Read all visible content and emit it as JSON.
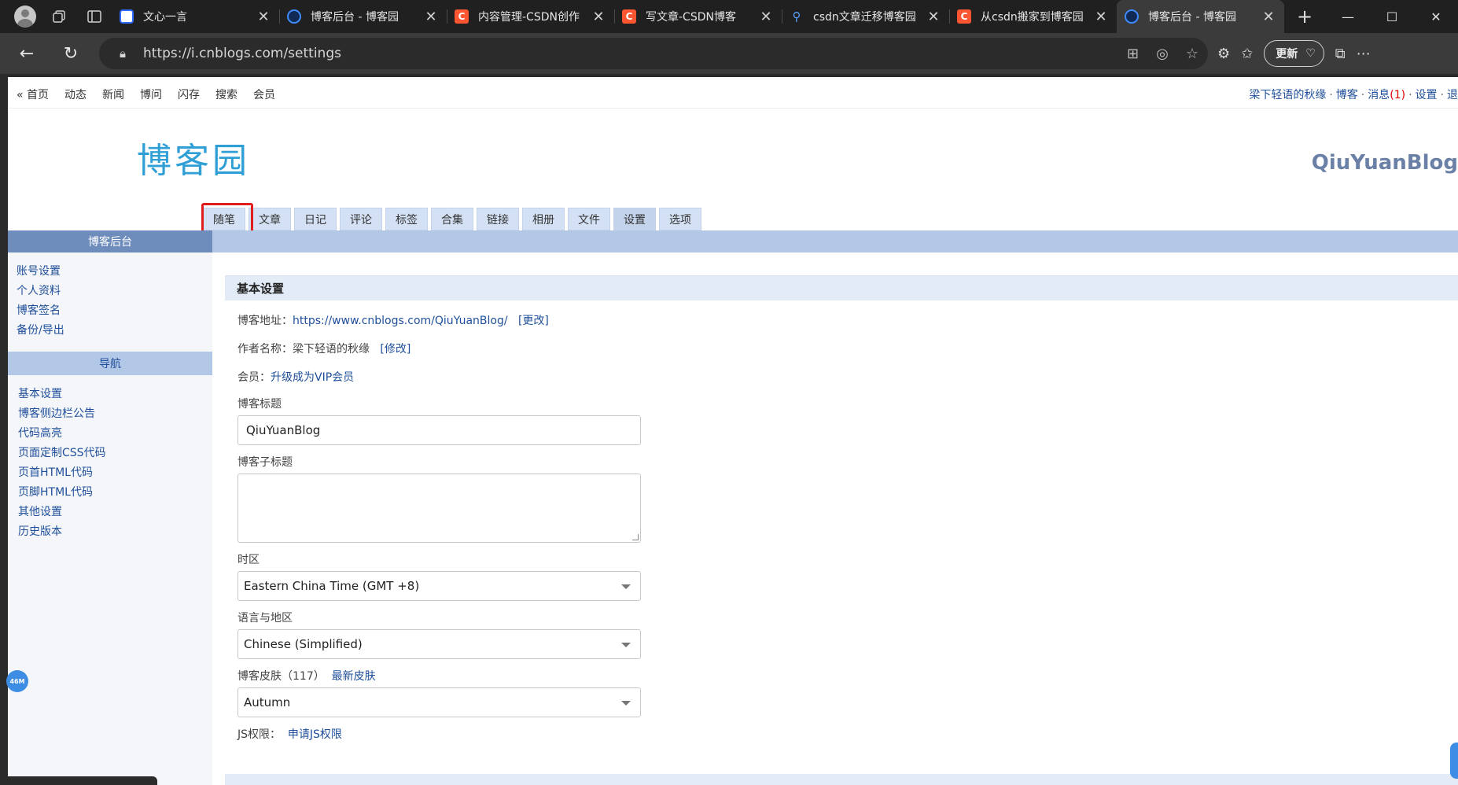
{
  "browser": {
    "tabs": [
      {
        "title": "文心一言",
        "favicon": "wenxin-icon",
        "active": false
      },
      {
        "title": "博客后台 - 博客园",
        "favicon": "cnblogs-icon",
        "active": false
      },
      {
        "title": "内容管理-CSDN创作",
        "favicon": "csdn-icon",
        "active": false
      },
      {
        "title": "写文章-CSDN博客",
        "favicon": "csdn-icon",
        "active": false
      },
      {
        "title": "csdn文章迁移博客园",
        "favicon": "search-icon",
        "active": false
      },
      {
        "title": "从csdn搬家到博客园",
        "favicon": "csdn-icon",
        "active": false
      },
      {
        "title": "博客后台 - 博客园",
        "favicon": "cnblogs-icon",
        "active": true
      }
    ],
    "url": "https://i.cnblogs.com/settings",
    "update_label": "更新"
  },
  "topnav": {
    "left": [
      "« 首页",
      "动态",
      "新闻",
      "博问",
      "闪存",
      "搜索",
      "会员"
    ],
    "user": "梁下轻语的秋缘",
    "blog": "博客",
    "messages": "消息",
    "message_count": "(1)",
    "settings": "设置",
    "more": "退"
  },
  "brand": {
    "logo": "博客园",
    "blog_title": "QiuYuanBlog"
  },
  "main_tabs": [
    "随笔",
    "文章",
    "日记",
    "评论",
    "标签",
    "合集",
    "链接",
    "相册",
    "文件",
    "设置",
    "选项"
  ],
  "sidebar": {
    "header": "博客后台",
    "account_links": [
      "账号设置",
      "个人资料",
      "博客签名",
      "备份/导出"
    ],
    "nav_header": "导航",
    "nav_links": [
      "基本设置",
      "博客侧边栏公告",
      "代码高亮",
      "页面定制CSS代码",
      "页首HTML代码",
      "页脚HTML代码",
      "其他设置",
      "历史版本"
    ]
  },
  "settings": {
    "section_title": "基本设置",
    "blog_url_label": "博客地址：",
    "blog_url": "https://www.cnblogs.com/QiuYuanBlog/",
    "blog_url_change": "[更改]",
    "author_label": "作者名称：",
    "author_name": "梁下轻语的秋缘",
    "author_edit": "[修改]",
    "member_label": "会员：",
    "member_link": "升级成为VIP会员",
    "title_label": "博客标题",
    "title_value": "QiuYuanBlog",
    "subtitle_label": "博客子标题",
    "subtitle_value": "",
    "timezone_label": "时区",
    "timezone_value": "Eastern China Time (GMT +8)",
    "language_label": "语言与地区",
    "language_value": "Chinese (Simplified)",
    "skin_label": "博客皮肤",
    "skin_count": "（117）",
    "skin_latest": "最新皮肤",
    "skin_value": "Autumn",
    "js_label": "JS权限：",
    "js_link": "申请JS权限"
  },
  "overlay": {
    "perf_badge": "46M"
  },
  "colors": {
    "highlight_box": "#e01e1e",
    "link": "#1f4f9a",
    "tab_bg": "#d4e1f4",
    "sidebar_head": "#6f8dbc"
  }
}
